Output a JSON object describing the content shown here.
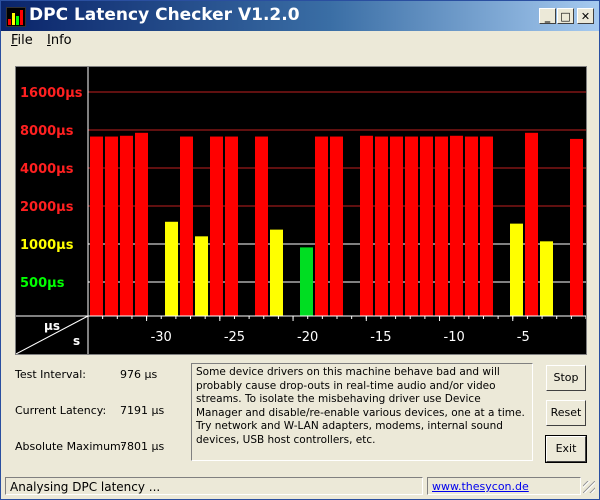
{
  "window": {
    "title": "DPC Latency Checker V1.2.0"
  },
  "titlebar_buttons": {
    "minimize": "_",
    "maximize": "□",
    "close": "✕"
  },
  "menu": {
    "items": [
      {
        "label_u": "F",
        "label_rest": "ile"
      },
      {
        "label_u": "I",
        "label_rest": "nfo"
      }
    ]
  },
  "chart_data": {
    "type": "bar",
    "ylabel": "µs",
    "xlabel": "s",
    "y_scale": "log",
    "y_ticks": [
      {
        "label": "16000µs",
        "value": 16000,
        "color": "#ff2020"
      },
      {
        "label": "8000µs",
        "value": 8000,
        "color": "#ff2020"
      },
      {
        "label": "4000µs",
        "value": 4000,
        "color": "#ff2020"
      },
      {
        "label": "2000µs",
        "value": 2000,
        "color": "#ff2020"
      },
      {
        "label": "1000µs",
        "value": 1000,
        "color": "#ffff00"
      },
      {
        "label": "500µs",
        "value": 500,
        "color": "#00ff00"
      }
    ],
    "x_ticks": [
      "-30",
      "-25",
      "-20",
      "-15",
      "-10",
      "-5"
    ],
    "x_tick_values": [
      -30,
      -25,
      -20,
      -15,
      -10,
      -5
    ],
    "x_range": [
      -34,
      0
    ],
    "values": [
      7100,
      7100,
      7200,
      7600,
      200,
      1500,
      7100,
      1150,
      7100,
      7100,
      200,
      7100,
      1300,
      200,
      940,
      7100,
      7100,
      200,
      7200,
      7100,
      7100,
      7100,
      7100,
      7100,
      7200,
      7100,
      7100,
      200,
      1450,
      7600,
      1050,
      200,
      6800
    ],
    "grid": true
  },
  "info": {
    "test_interval_label": "Test Interval:",
    "test_interval_value": "976 µs",
    "current_latency_label": "Current Latency:",
    "current_latency_value": "7191 µs",
    "absolute_maximum_label": "Absolute Maximum:",
    "absolute_maximum_value": "7801 µs"
  },
  "message": "Some device drivers on this machine behave bad and will probably cause drop-outs in real-time audio and/or video streams. To isolate the misbehaving driver use Device Manager and disable/re-enable various devices, one at a time. Try network and W-LAN adapters, modems, internal sound devices, USB host controllers, etc.",
  "buttons": {
    "stop": "Stop",
    "reset": "Reset",
    "exit": "Exit"
  },
  "status": {
    "text": "Analysing DPC latency ...",
    "link": "www.thesycon.de"
  }
}
